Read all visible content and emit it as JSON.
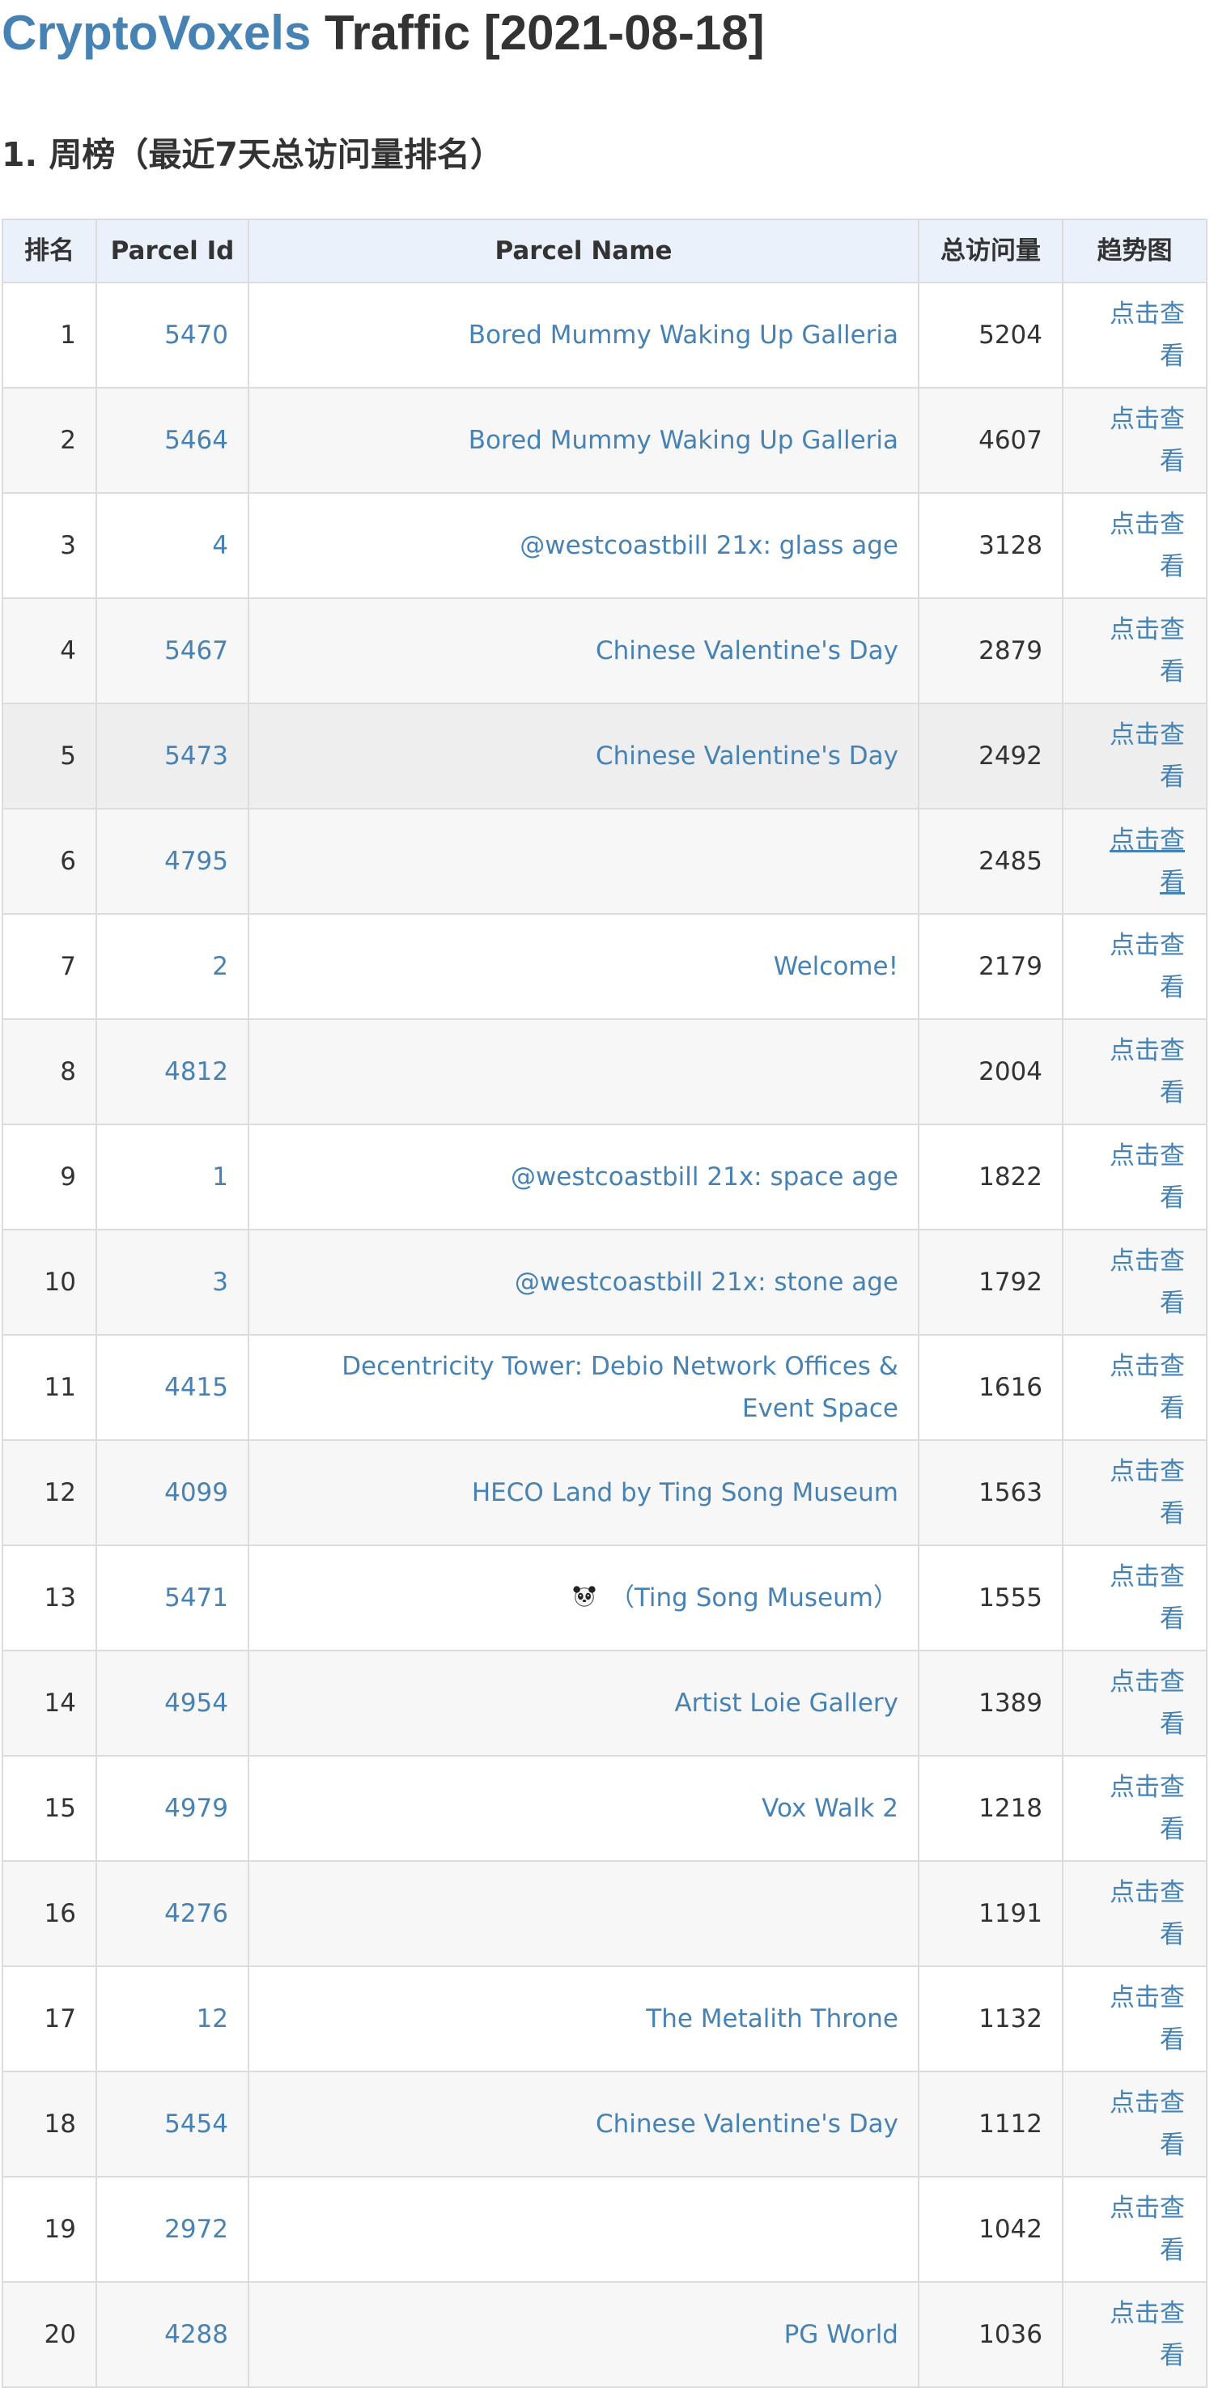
{
  "header": {
    "brand": "CryptoVoxels",
    "title_rest": " Traffic [2021-08-18]"
  },
  "section": {
    "title": "1. 周榜（最近7天总访问量排名）"
  },
  "table": {
    "columns": {
      "rank": "排名",
      "parcel_id": "Parcel Id",
      "parcel_name": "Parcel Name",
      "visits": "总访问量",
      "trend": "趋势图"
    },
    "trend_link_label": "点击查看",
    "rows": [
      {
        "rank": "1",
        "parcel_id": "5470",
        "name": "Bored Mummy Waking Up Galleria",
        "visits": "5204"
      },
      {
        "rank": "2",
        "parcel_id": "5464",
        "name": "Bored Mummy Waking Up Galleria",
        "visits": "4607"
      },
      {
        "rank": "3",
        "parcel_id": "4",
        "name": "@westcoastbill 21x: glass age",
        "visits": "3128"
      },
      {
        "rank": "4",
        "parcel_id": "5467",
        "name": "Chinese Valentine's Day",
        "visits": "2879"
      },
      {
        "rank": "5",
        "parcel_id": "5473",
        "name": "Chinese Valentine's Day",
        "visits": "2492"
      },
      {
        "rank": "6",
        "parcel_id": "4795",
        "name": "",
        "visits": "2485"
      },
      {
        "rank": "7",
        "parcel_id": "2",
        "name": "Welcome!",
        "visits": "2179"
      },
      {
        "rank": "8",
        "parcel_id": "4812",
        "name": "",
        "visits": "2004"
      },
      {
        "rank": "9",
        "parcel_id": "1",
        "name": "@westcoastbill 21x: space age",
        "visits": "1822"
      },
      {
        "rank": "10",
        "parcel_id": "3",
        "name": "@westcoastbill 21x: stone age",
        "visits": "1792"
      },
      {
        "rank": "11",
        "parcel_id": "4415",
        "name": "Decentricity Tower: Debio Network Offices & Event Space",
        "visits": "1616"
      },
      {
        "rank": "12",
        "parcel_id": "4099",
        "name": "HECO Land by Ting Song Museum",
        "visits": "1563"
      },
      {
        "rank": "13",
        "parcel_id": "5471",
        "name": "（Ting Song Museum）",
        "visits": "1555"
      },
      {
        "rank": "14",
        "parcel_id": "4954",
        "name": "Artist Loie Gallery",
        "visits": "1389"
      },
      {
        "rank": "15",
        "parcel_id": "4979",
        "name": "Vox Walk 2",
        "visits": "1218"
      },
      {
        "rank": "16",
        "parcel_id": "4276",
        "name": "",
        "visits": "1191"
      },
      {
        "rank": "17",
        "parcel_id": "12",
        "name": "The Metalith Throne",
        "visits": "1132"
      },
      {
        "rank": "18",
        "parcel_id": "5454",
        "name": "Chinese Valentine's Day",
        "visits": "1112"
      },
      {
        "rank": "19",
        "parcel_id": "2972",
        "name": "",
        "visits": "1042"
      },
      {
        "rank": "20",
        "parcel_id": "4288",
        "name": "PG World",
        "visits": "1036"
      }
    ]
  },
  "icons": {
    "row13_prefix": "panda-icon"
  },
  "colors": {
    "link": "#4682b4",
    "header_bg": "#eaf1fb",
    "stripe": "#f7f7f7",
    "border": "#dcdcdc"
  }
}
